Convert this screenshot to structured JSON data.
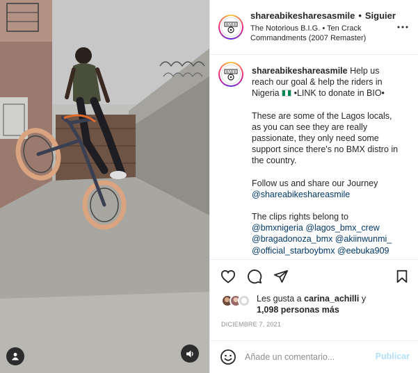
{
  "post": {
    "username": "shareabikesharesasmile",
    "follow_label": "Siguier",
    "song": "The Notorious B.I.G. • Ten Crack Commandments (2007 Remaster)",
    "avatar_icon": "logo-avatar"
  },
  "caption": {
    "username": "shareabikeshareasmile",
    "line1": "Help us reach our goal & help the riders in Nigeria",
    "flag_icon": "nigeria-flag",
    "line1_tail": "•LINK to donate in BIO•",
    "para2": "These are some of the Lagos locals, as you can see they are really passionate, they only need some support since there's no BMX distro in the country.",
    "para3": "Follow us and share our Journey",
    "para3_mention": "@shareabikeshareasmile",
    "para4": "The clips rights belong to",
    "mentions": [
      "@bmxnigeria",
      "@lagos_bmx_crew",
      "@bragadonoza_bmx",
      "@akiinwunmi_",
      "@official_starboybmx",
      "@eebuka909"
    ]
  },
  "actions": {
    "like_icon": "heart-icon",
    "comment_icon": "comment-icon",
    "share_icon": "send-icon",
    "save_icon": "bookmark-icon"
  },
  "likes": {
    "prefix": "Les gusta a",
    "first_user": "carina_achilli",
    "joiner": "y",
    "others": "1,098 personas más"
  },
  "date": "DICIEMBRE 7, 2021",
  "comment_box": {
    "placeholder": "Añade un comentario...",
    "publish_label": "Publicar"
  },
  "colors": {
    "mention": "#00376b",
    "publish_disabled": "#b2dffc",
    "muted": "#8e8e8e"
  }
}
